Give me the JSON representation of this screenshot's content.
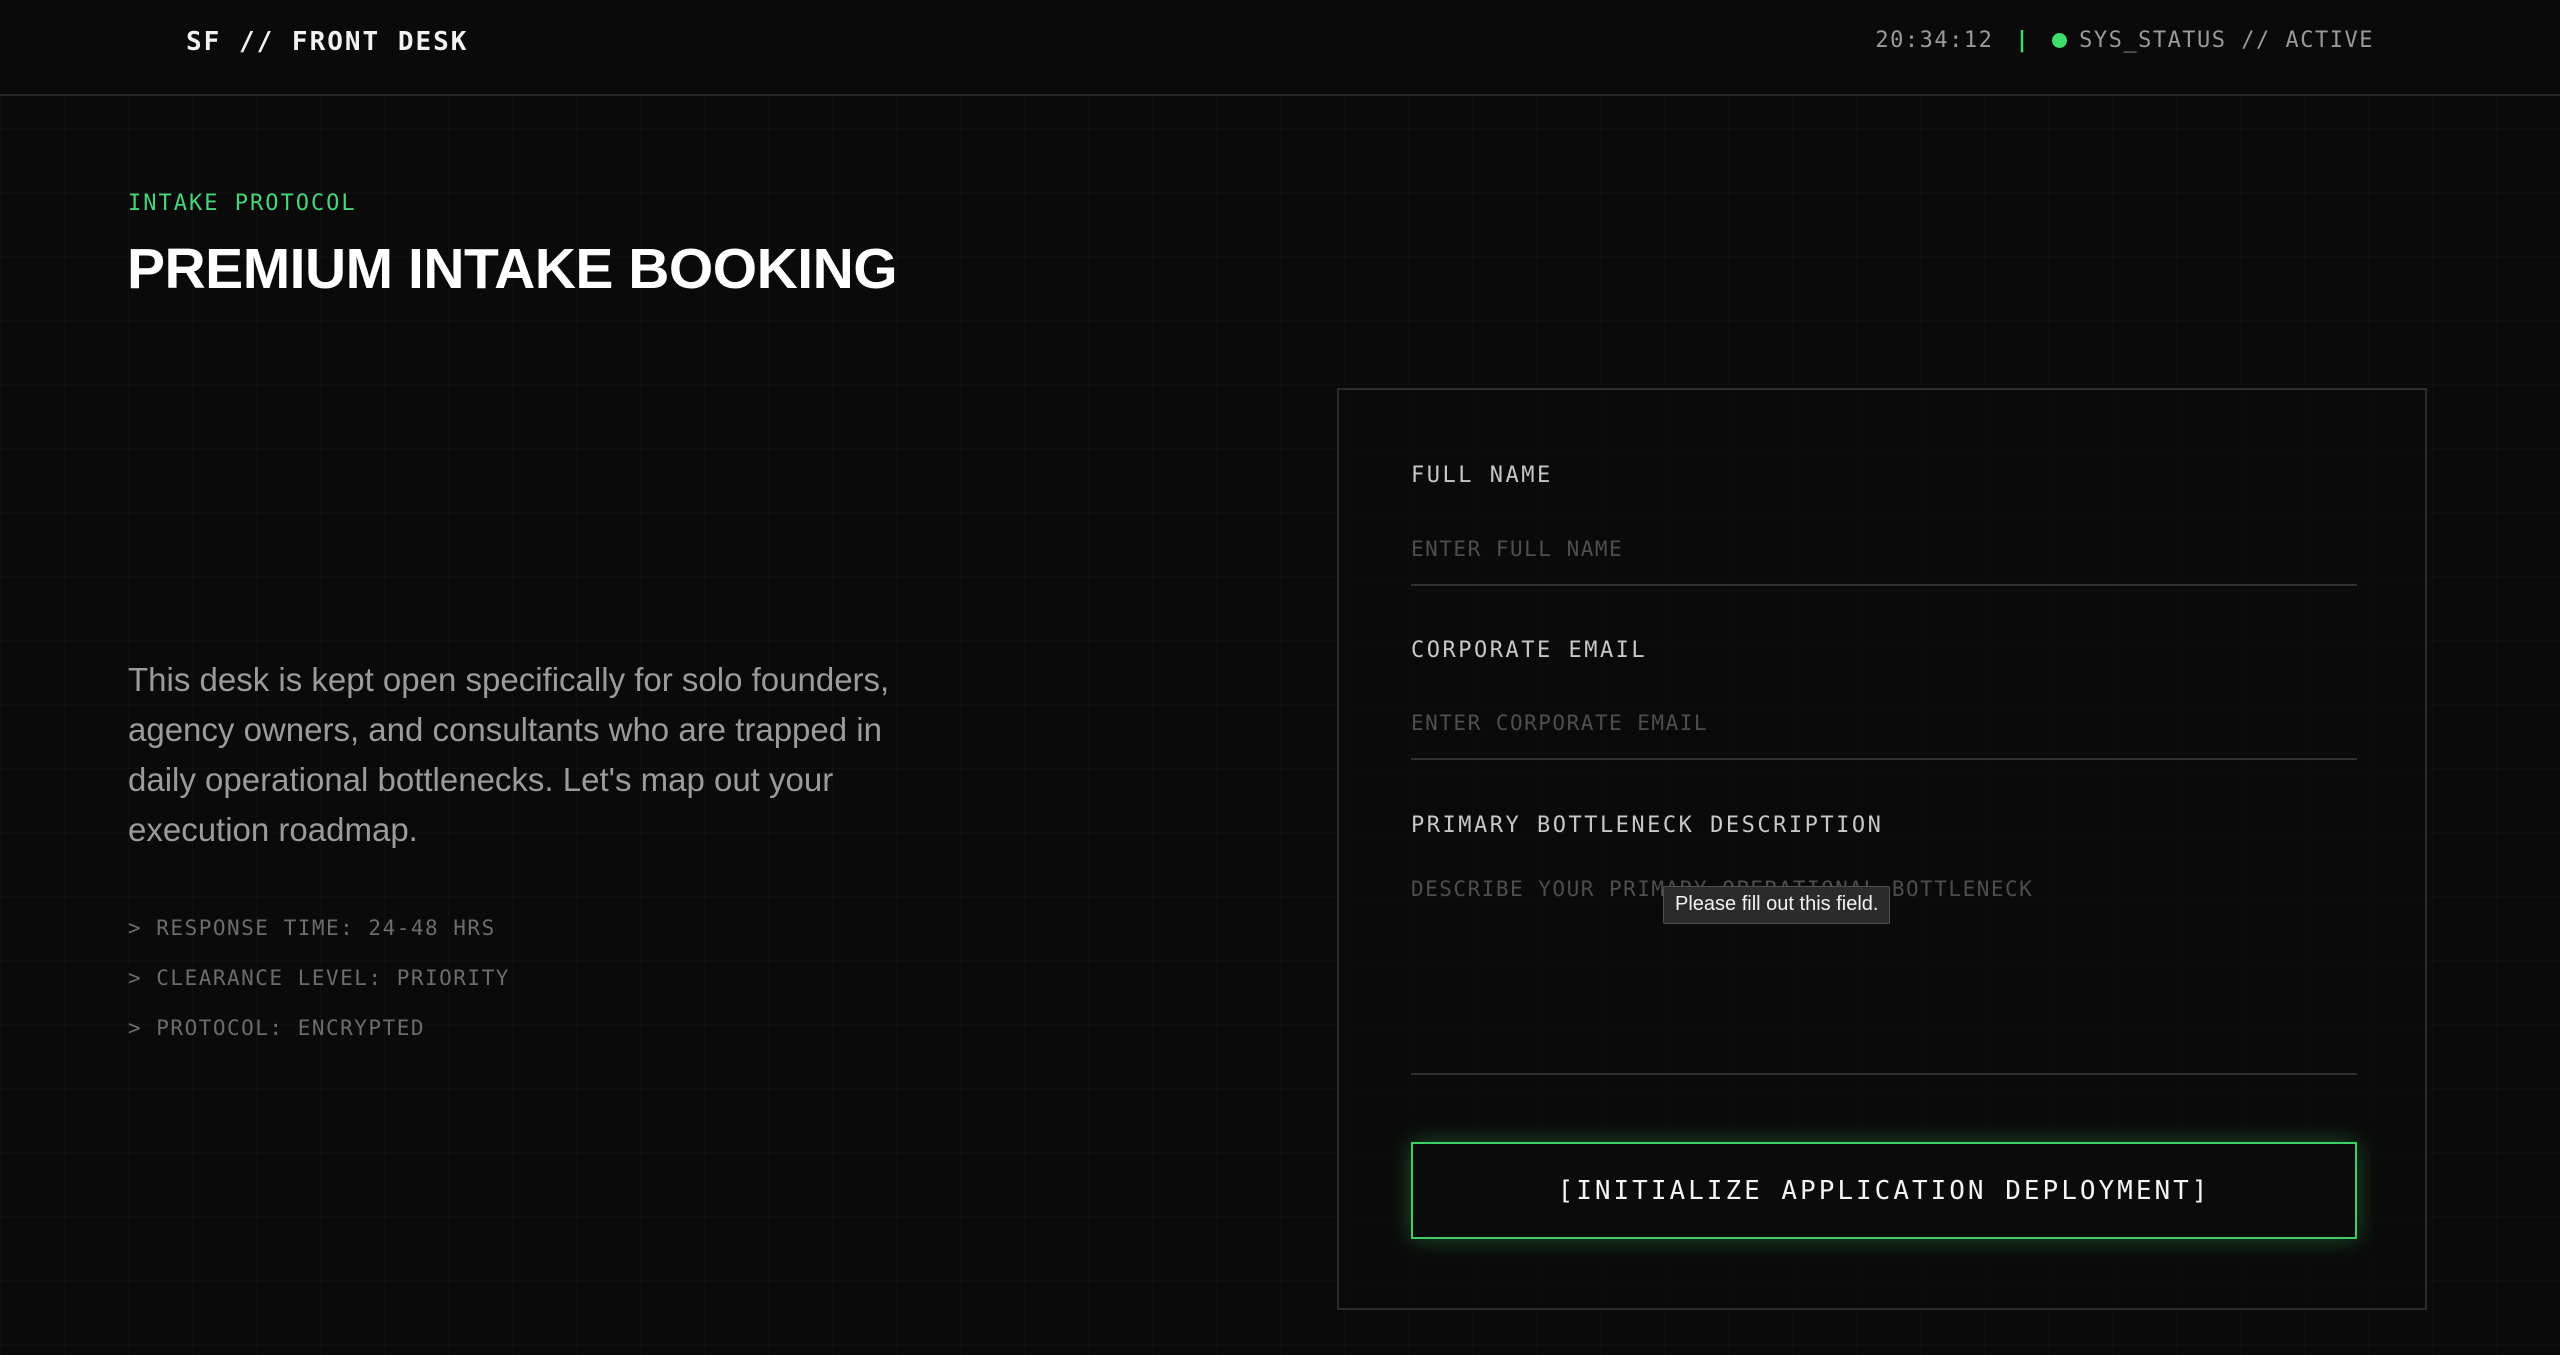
{
  "header": {
    "brand": "SF // FRONT DESK",
    "clock": "20:34:12",
    "separator": "|",
    "status": "SYS_STATUS // ACTIVE",
    "status_color": "#3fdc6e"
  },
  "hero": {
    "eyebrow": "INTAKE PROTOCOL",
    "title": "PREMIUM INTAKE BOOKING",
    "intro": "This desk is kept open specifically for solo founders, agency owners, and consultants who are trapped in daily operational bottlenecks. Let's map out your execution roadmap.",
    "specs": [
      "> RESPONSE TIME: 24-48 HRS",
      "> CLEARANCE LEVEL: PRIORITY",
      "> PROTOCOL: ENCRYPTED"
    ]
  },
  "form": {
    "full_name": {
      "label": "FULL NAME",
      "placeholder": "ENTER FULL NAME",
      "value": ""
    },
    "email": {
      "label": "CORPORATE EMAIL",
      "placeholder": "ENTER CORPORATE EMAIL",
      "value": ""
    },
    "bottleneck": {
      "label": "PRIMARY BOTTLENECK DESCRIPTION",
      "placeholder": "DESCRIBE YOUR PRIMARY OPERATIONAL BOTTLENECK",
      "value": ""
    },
    "submit_label": "[INITIALIZE APPLICATION DEPLOYMENT]",
    "validation_tooltip": "Please fill out this field."
  },
  "colors": {
    "background": "#0a0a0a",
    "accent": "#3fcf68",
    "eyebrow": "#48d47a"
  }
}
